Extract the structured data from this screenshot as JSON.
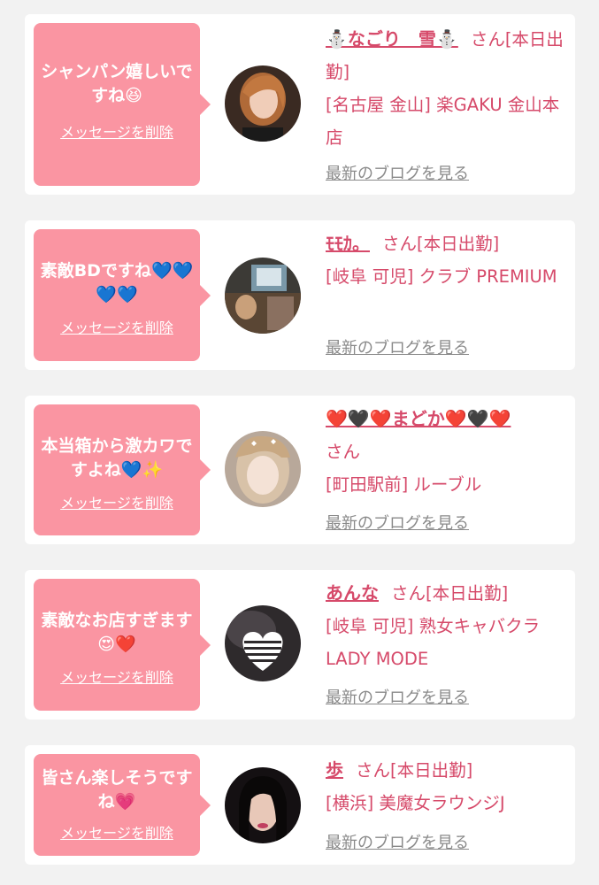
{
  "posts": [
    {
      "message": "シャンパン嬉しいですね😆",
      "delete_label": "メッセージを削除",
      "name": "⛄なごり　雪⛄",
      "san": "さん",
      "status": "[本日出勤]",
      "shop": "[名古屋 金山] 楽GAKU 金山本店",
      "blog_label": "最新のブログを見る"
    },
    {
      "message": "素敵BDですね💙💙💙💙",
      "delete_label": "メッセージを削除",
      "name": "ﾓﾓｶ。",
      "san": "さん",
      "status": "[本日出勤]",
      "shop": "[岐阜 可児] クラブ PREMIUM",
      "blog_label": "最新のブログを見る"
    },
    {
      "message": "本当箱から激カワですよね💙✨",
      "delete_label": "メッセージを削除",
      "name": "❤️🖤❤️まどか❤️🖤❤️",
      "san": "さん",
      "status": "",
      "shop": "[町田駅前] ルーブル",
      "blog_label": "最新のブログを見る"
    },
    {
      "message": "素敵なお店すぎます😍❤️",
      "delete_label": "メッセージを削除",
      "name": "あんな",
      "san": "さん",
      "status": "[本日出勤]",
      "shop": "[岐阜 可児] 熟女キャバクラ LADY MODE",
      "blog_label": "最新のブログを見る"
    },
    {
      "message": "皆さん楽しそうですね💗",
      "delete_label": "メッセージを削除",
      "name": "歩",
      "san": "さん",
      "status": "[本日出勤]",
      "shop": "[横浜] 美魔女ラウンジJ",
      "blog_label": "最新のブログを見る"
    }
  ],
  "colors": {
    "bubble": "#fa95a2",
    "accent": "#d64a6a",
    "muted": "#8a8a8a",
    "background": "#f2f2f2"
  }
}
